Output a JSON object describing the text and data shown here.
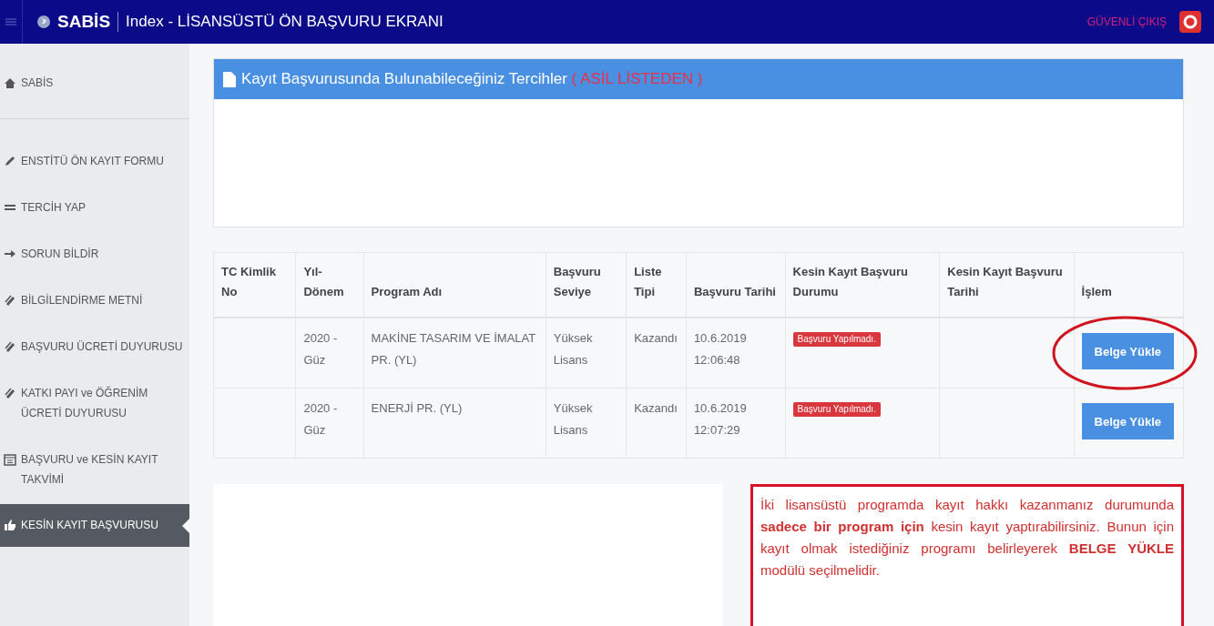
{
  "header": {
    "brand": "SABİS",
    "title": "Index - LİSANSÜSTÜ ÖN BAŞVURU EKRANI",
    "logout": "GÜVENLİ ÇIKIŞ"
  },
  "sidebar": {
    "items": [
      {
        "kind": "home",
        "label": "SABİS",
        "selected": false
      },
      {
        "kind": "pencil",
        "label": "ENSTİTÜ ÖN KAYIT FORMU",
        "selected": false
      },
      {
        "kind": "list",
        "label": "TERCİH YAP",
        "selected": false
      },
      {
        "kind": "arrow",
        "label": "SORUN BİLDİR",
        "selected": false
      },
      {
        "kind": "clip",
        "label": "BİLGİLENDİRME METNİ",
        "selected": false
      },
      {
        "kind": "clip",
        "label": "BAŞVURU ÜCRETİ DUYURUSU",
        "selected": false
      },
      {
        "kind": "clip",
        "label": "KATKI PAYI ve ÖĞRENİM ÜCRETİ DUYURUSU",
        "selected": false
      },
      {
        "kind": "calendar",
        "label": "BAŞVURU ve KESİN KAYIT TAKVİMİ",
        "selected": false
      },
      {
        "kind": "thumb",
        "label": "KESİN KAYIT BAŞVURUSU",
        "selected": true
      }
    ]
  },
  "panel": {
    "title": "Kayıt Başvurusunda Bulunabileceğiniz Tercihler",
    "tag": "( ASİL LİSTEDEN )"
  },
  "table": {
    "columns": [
      "TC Kimlik No",
      "Yıl-Dönem",
      "Program Adı",
      "Başvuru Seviye",
      "Liste Tipi",
      "Başvuru Tarihi",
      "Kesin Kayıt Başvuru Durumu",
      "Kesin Kayıt Başvuru Tarihi",
      "İşlem"
    ],
    "rows": [
      {
        "period": "2020 - Güz",
        "program": "MAKİNE TASARIM VE İMALAT PR. (YL)",
        "level": "Yüksek Lisans",
        "list_type": "Kazandı",
        "date": "10.6.2019 12:06:48",
        "status": "Başvuru Yapılmadı.",
        "action": "Belge Yükle",
        "circled": true
      },
      {
        "period": "2020 - Güz",
        "program": "ENERJİ PR. (YL)",
        "level": "Yüksek Lisans",
        "list_type": "Kazandı",
        "date": "10.6.2019 12:07:29",
        "status": "Başvuru Yapılmadı.",
        "action": "Belge Yükle",
        "circled": false
      }
    ]
  },
  "notice": "İki lisansüstü programda kayıt hakkı kazanmanız durumunda **sadece bir program için** kesin kayıt yaptırabilirsiniz. Bunun için kayıt olmak istediğiniz programı belirleyerek **BELGE YÜKLE** modülü seçilmelidir."
}
